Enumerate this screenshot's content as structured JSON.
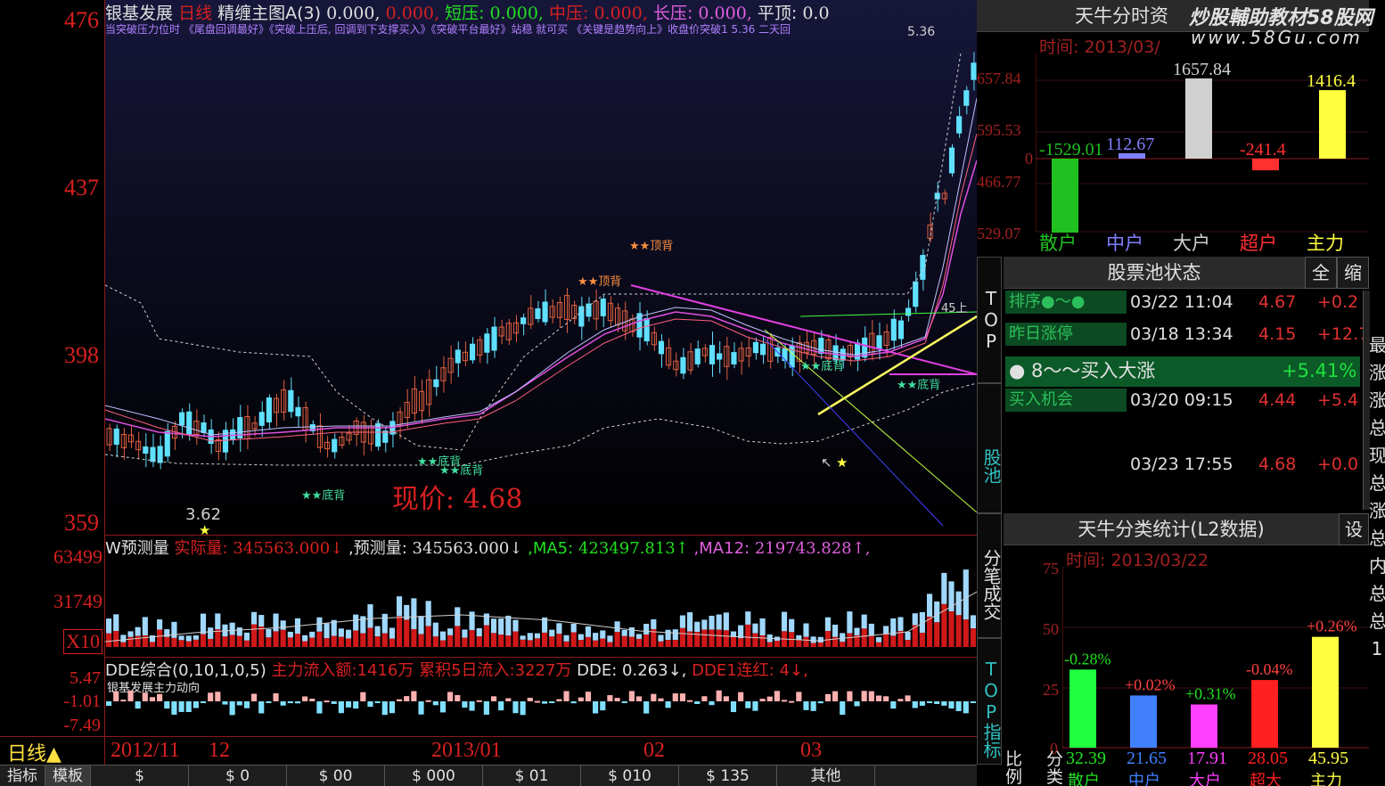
{
  "title_bar": {
    "stock": "银基发展",
    "period": "日线",
    "indicator": "精缠主图A(3)",
    "val1": "0.000,",
    "val2": "0.000,",
    "short_label": "短压:",
    "short_val": "0.000,",
    "mid_label": "中压:",
    "mid_val": "0.000,",
    "long_label": "长压:",
    "long_val": "0.000,",
    "top_label": "平顶:",
    "top_val": "0.0"
  },
  "note_bar": "当突破压力位时 《尾盘回调最好》《突破上压后, 回调到下支撑买入》《突破平台最好》站稳 就可买 《关键是趋势向上》收盘价突破1 5.36 二天回",
  "price_axis": {
    "p1": "476",
    "p2": "437",
    "p3": "398",
    "p4": "359"
  },
  "main_annotations": {
    "top_back_1": "★★顶背",
    "top_back_2": "★★顶背",
    "bottom_back_1": "★★底背",
    "bottom_back_2": "★★底背",
    "bottom_back_3": "★★底背",
    "bottom_back_4": "★★底背",
    "bottom_back_5": "★★底背",
    "low_marker": "3.62",
    "high_marker": "5.36",
    "line_label": "45上",
    "star": "★",
    "arrow": "↖",
    "current_price": "现价: 4.68"
  },
  "volume": {
    "axis_top": "63499",
    "axis_mid": "31749",
    "axis_unit": "X10",
    "name": "W预测量",
    "actual_label": "实际量:",
    "actual_val": "345563.000↓",
    "forecast_label": ",预测量:",
    "forecast_val": "345563.000↓",
    "ma5_label": ",MA5:",
    "ma5_val": "423497.813↑",
    "ma12_label": ",MA12:",
    "ma12_val": "219743.828↑,"
  },
  "dde": {
    "axis_top": "5.47",
    "axis_mid": "-1.01",
    "axis_bot": "-7.49",
    "name": "DDE综合(0,10,1,0,5)",
    "inflow": "主力流入额:1416万",
    "inflow5": "累积5日流入:3227万",
    "dde_val": "DDE: 0.263↓,",
    "dde1": "DDE1连红: 4↓,",
    "sub": "银基发展主力动向"
  },
  "period_indicator": "日线▲",
  "date_axis": [
    "2012/11",
    "12",
    "2013/01",
    "02",
    "03"
  ],
  "bottom_tabs": [
    "指标",
    "模板",
    "$",
    "$ 0",
    "$ 00",
    "$ 000",
    "$ 01",
    "$ 010",
    "$ 135",
    "其他"
  ],
  "side_tabs": {
    "top": "TOP",
    "pool": "股池",
    "trades": "分笔成交",
    "top_indicator": "TOP指标"
  },
  "capital_panel": {
    "title": "天牛分时资",
    "watermark1": "炒股輔助教材58股网",
    "watermark2": "www.58Gu.com",
    "time_label": "时间: 2013/03/",
    "axis": [
      "657.84",
      "595.53",
      "0",
      "466.77",
      "529.07"
    ],
    "categories": [
      "散户",
      "中户",
      "大户",
      "超户",
      "主力"
    ],
    "values": [
      -1529.01,
      112.67,
      1657.84,
      -241.4,
      1416.4
    ],
    "value_labels": [
      "-1529.01",
      "112.67",
      "1657.84",
      "-241.4",
      "1416.4"
    ]
  },
  "stock_pool": {
    "title": "股票池状态",
    "btn_all": "全",
    "btn_shrink": "缩",
    "rows": [
      {
        "tag": "排序●～●",
        "time": "03/22 11:04",
        "price": "4.67",
        "chg": "+0.2"
      },
      {
        "tag": "昨日涨停",
        "time": "03/18 13:34",
        "price": "4.15",
        "chg": "+12.7"
      },
      {
        "tag": "8～～买入大涨",
        "time": "",
        "price": "",
        "chg": "+5.41%"
      },
      {
        "tag": "买入机会",
        "time": "03/20 09:15",
        "price": "4.44",
        "chg": "+5.4"
      },
      {
        "tag": "",
        "time": "03/23 17:55",
        "price": "4.68",
        "chg": "+0.0"
      }
    ]
  },
  "l2_panel": {
    "title": "天牛分类统计(L2数据)",
    "btn": "设",
    "time_label": "时间: 2013/03/22",
    "axis": [
      "75",
      "50",
      "25",
      "0"
    ],
    "categories": [
      "散户",
      "中户",
      "大户",
      "超大",
      "主力"
    ],
    "pct_labels": [
      "-0.28%",
      "+0.02%",
      "+0.31%",
      "-0.04%",
      "+0.26%"
    ],
    "ratio_label": "比例",
    "class_label": "分类",
    "ratios": [
      "32.39",
      "21.65",
      "17.91",
      "28.05",
      "45.95"
    ]
  },
  "right_edge": "最涨涨总现总涨总内总总1",
  "chart_data": [
    {
      "type": "bar",
      "title": "天牛分时资",
      "categories": [
        "散户",
        "中户",
        "大户",
        "超户",
        "主力"
      ],
      "values": [
        -1529.01,
        112.67,
        1657.84,
        -241.4,
        1416.4
      ],
      "colors": [
        "#20c020",
        "#8080ff",
        "#d0d0d0",
        "#ff3030",
        "#ffff40"
      ]
    },
    {
      "type": "bar",
      "title": "天牛分类统计(L2数据)",
      "categories": [
        "散户",
        "中户",
        "大户",
        "超大",
        "主力"
      ],
      "values": [
        32.39,
        21.65,
        17.91,
        28.05,
        45.95
      ],
      "ylim": [
        0,
        75
      ],
      "colors": [
        "#20ff40",
        "#4080ff",
        "#ff40ff",
        "#ff2020",
        "#ffff40"
      ]
    }
  ]
}
